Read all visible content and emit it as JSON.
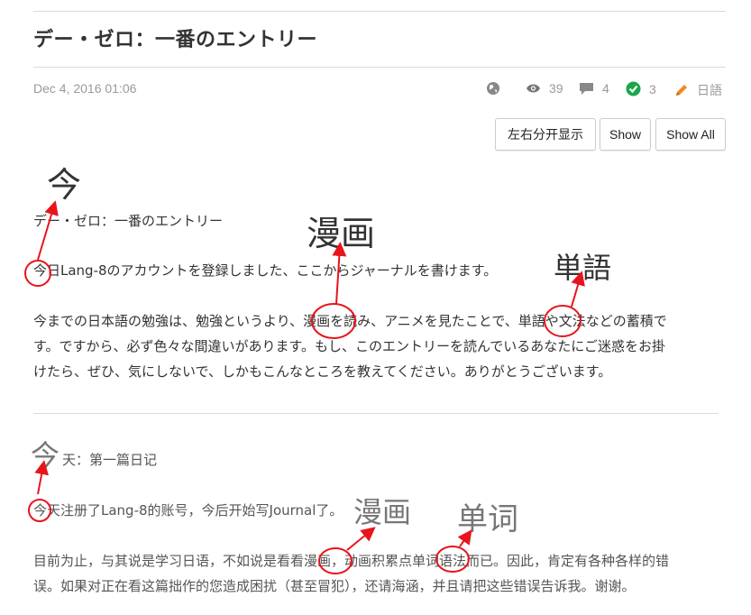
{
  "entry": {
    "title": "デー・ゼロ：一番のエントリー",
    "date": "Dec 4, 2016 01:06",
    "stats": {
      "views": "39",
      "comments": "4",
      "corrections": "3",
      "language": "日語"
    },
    "buttons": {
      "split": "左右分开显示",
      "show": "Show",
      "show_all": "Show All"
    }
  },
  "japanese": {
    "heading": "デー・ゼロ：一番のエントリー",
    "line1": "今日Lang-8のアカウントを登録しました、ここからジャーナルを書けます。",
    "para_lines": [
      "今までの日本語の勉強は、勉強というより、漫画を読み、アニメを見たことで、単語や文法などの蓄積で",
      "す。ですから、必ず色々な間違いがあります。もし、このエントリーを読んでいるあなたにご迷惑をお掛",
      "けたら、ぜひ、気にしないで、しかもこんなところを教えてください。ありがとうございます。"
    ]
  },
  "chinese": {
    "heading_suffix": "天：第一篇日记",
    "line1": "今天注册了Lang-8的账号，今后开始写Journal了。",
    "para_lines": [
      "目前为止，与其说是学习日语，不如说是看看漫画，动画积累点单词语法而已。因此，肯定有各种各样的错",
      "误。如果对正在看这篇拙作的您造成困扰（甚至冒犯），还请海涵，并且请把这些错误告诉我。谢谢。"
    ]
  },
  "annotations": {
    "jp_kon": "今",
    "jp_manga": "漫画",
    "jp_tango": "単語",
    "zh_jin": "今",
    "zh_manhua": "漫画",
    "zh_danci": "单词"
  },
  "colors": {
    "arrow": "#e8141c",
    "accent_green": "#1aa64a",
    "accent_orange": "#f08a24",
    "text_muted": "#999999"
  }
}
